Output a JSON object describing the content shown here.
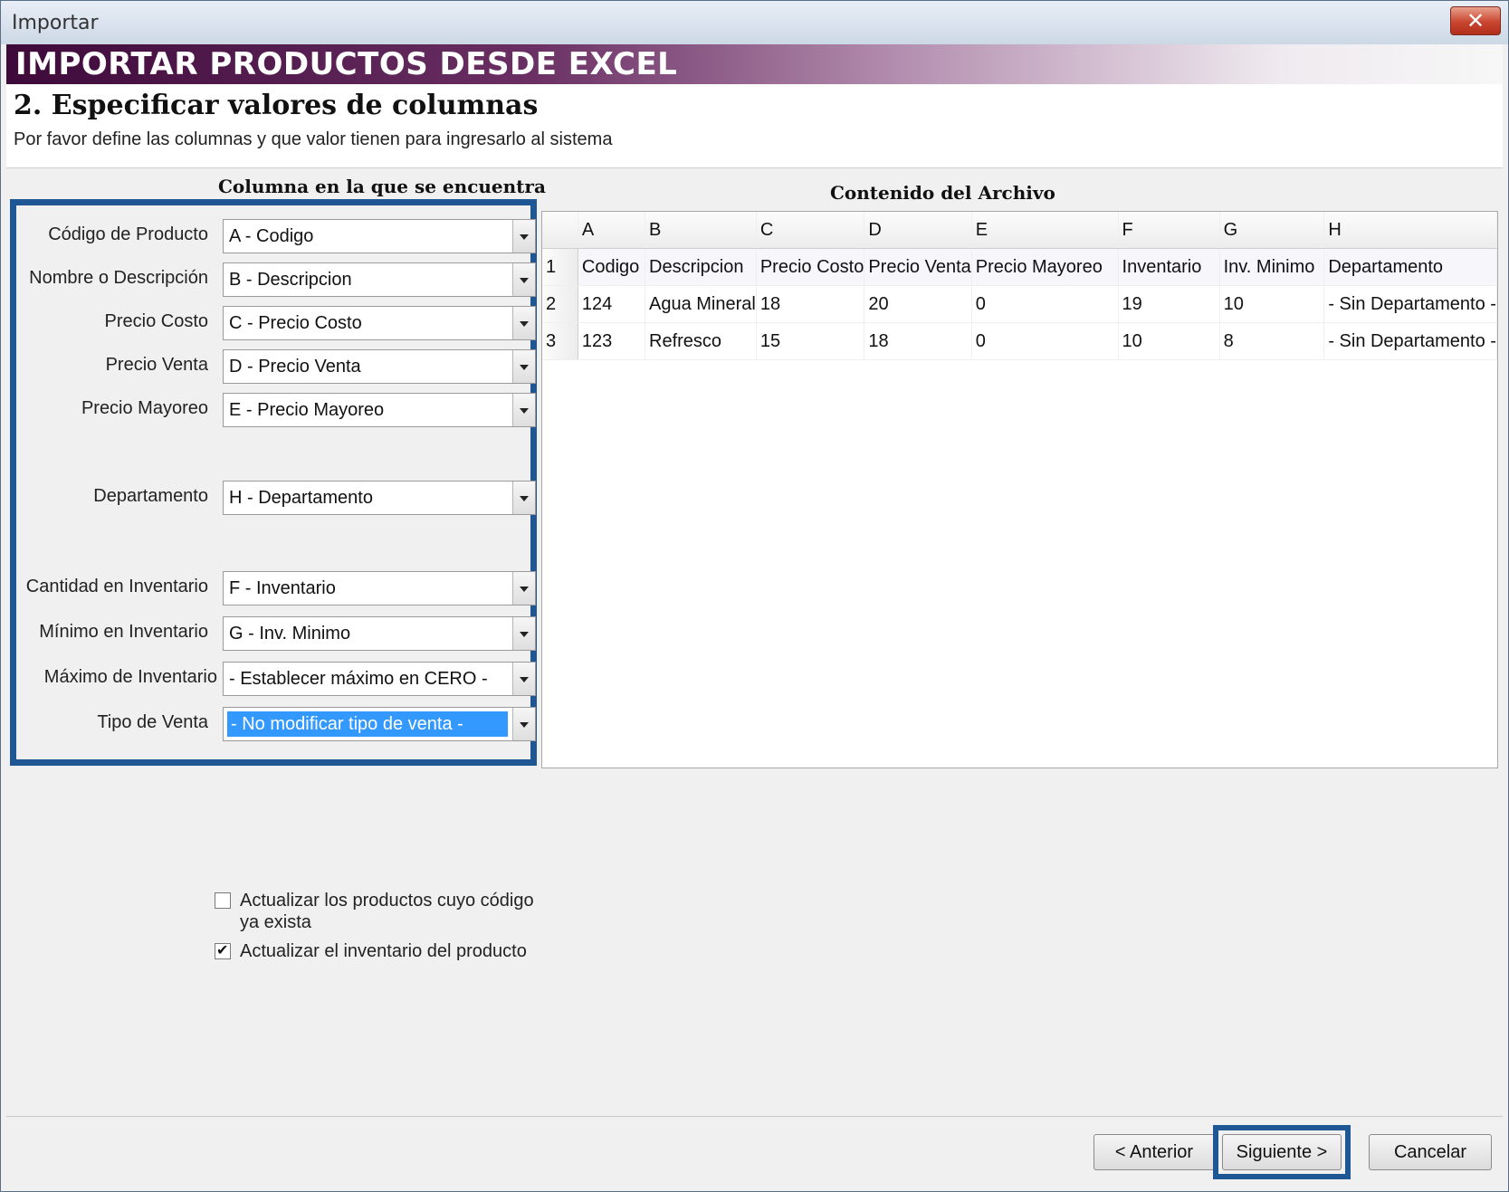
{
  "window": {
    "title": "Importar"
  },
  "banner": {
    "text": "IMPORTAR PRODUCTOS DESDE EXCEL"
  },
  "header": {
    "step_title": "2. Especificar valores de columnas",
    "description": "Por favor define las columnas y que valor tienen para ingresarlo al sistema"
  },
  "mapping": {
    "heading": "Columna en la que se encuentra",
    "fields": [
      {
        "label": "Código de Producto",
        "value": "A - Codigo"
      },
      {
        "label": "Nombre o Descripción",
        "value": "B - Descripcion"
      },
      {
        "label": "Precio Costo",
        "value": "C - Precio Costo"
      },
      {
        "label": "Precio Venta",
        "value": "D - Precio Venta"
      },
      {
        "label": "Precio Mayoreo",
        "value": "E - Precio Mayoreo"
      },
      {
        "label": "Departamento",
        "value": "H - Departamento"
      },
      {
        "label": "Cantidad en Inventario",
        "value": "F - Inventario"
      },
      {
        "label": "Mínimo en Inventario",
        "value": "G - Inv. Minimo"
      },
      {
        "label": "Máximo de Inventario",
        "value": "- Establecer máximo en CERO -"
      },
      {
        "label": "Tipo de Venta",
        "value": "- No modificar tipo de venta -"
      }
    ]
  },
  "file_content": {
    "heading": "Contenido del Archivo",
    "columns": [
      "A",
      "B",
      "C",
      "D",
      "E",
      "F",
      "G",
      "H"
    ],
    "rows": [
      {
        "num": "1",
        "cells": [
          "Codigo",
          "Descripcion",
          "Precio Costo",
          "Precio Venta",
          "Precio Mayoreo",
          "Inventario",
          "Inv. Minimo",
          "Departamento"
        ]
      },
      {
        "num": "2",
        "cells": [
          "124",
          "Agua Mineral",
          "18",
          "20",
          "0",
          "19",
          "10",
          "- Sin Departamento -"
        ]
      },
      {
        "num": "3",
        "cells": [
          "123",
          "Refresco",
          "15",
          "18",
          "0",
          "10",
          "8",
          "- Sin Departamento -"
        ]
      }
    ]
  },
  "options": {
    "update_existing_line1": "Actualizar los productos cuyo código",
    "update_existing_line2": "ya exista",
    "update_existing_checked": false,
    "update_inventory": "Actualizar el inventario del producto",
    "update_inventory_checked": true
  },
  "buttons": {
    "back": "< Anterior",
    "next": "Siguiente >",
    "cancel": "Cancelar"
  }
}
